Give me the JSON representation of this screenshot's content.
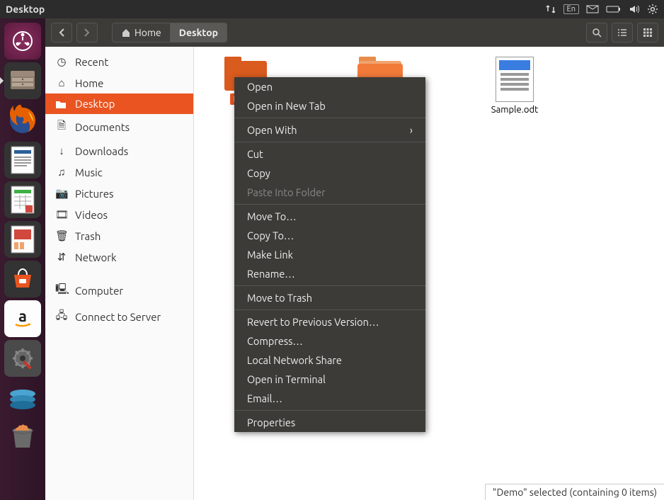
{
  "top_panel": {
    "title": "Desktop",
    "indicators": [
      "network-icon",
      "keyboard-icon",
      "mail-icon",
      "battery-icon",
      "volume-icon",
      "gear-icon"
    ],
    "keyboard_label": "En"
  },
  "launcher": {
    "items": [
      {
        "name": "dash-icon",
        "color": "#dd4814"
      },
      {
        "name": "files-icon",
        "color": "#6b6b6b"
      },
      {
        "name": "firefox-icon",
        "color": "#e66000"
      },
      {
        "name": "writer-icon",
        "color": "#2a6099"
      },
      {
        "name": "calc-icon",
        "color": "#3faf46"
      },
      {
        "name": "impress-icon",
        "color": "#d0483e"
      },
      {
        "name": "software-icon",
        "color": "#e95420"
      },
      {
        "name": "amazon-icon",
        "color": "#f0f0f0"
      },
      {
        "name": "settings-icon",
        "color": "#4a4a4a"
      },
      {
        "name": "devices-icon",
        "color": "#3399cc"
      },
      {
        "name": "trash-icon",
        "color": "#5a5a5a"
      }
    ]
  },
  "toolbar": {
    "back": "‹",
    "forward": "›",
    "path": [
      {
        "label": "Home",
        "icon": "home"
      },
      {
        "label": "Desktop",
        "active": true
      }
    ],
    "search": "search-icon",
    "view_list": "list-icon",
    "view_grid": "grid-icon"
  },
  "sidebar": {
    "items": [
      {
        "icon": "clock",
        "label": "Recent"
      },
      {
        "icon": "home",
        "label": "Home"
      },
      {
        "icon": "folder",
        "label": "Desktop",
        "active": true
      },
      {
        "icon": "doc",
        "label": "Documents"
      },
      {
        "icon": "download",
        "label": "Downloads"
      },
      {
        "icon": "music",
        "label": "Music"
      },
      {
        "icon": "camera",
        "label": "Pictures"
      },
      {
        "icon": "video",
        "label": "Videos"
      },
      {
        "icon": "trash",
        "label": "Trash"
      },
      {
        "icon": "network",
        "label": "Network"
      },
      {
        "icon": "computer",
        "label": "Computer"
      },
      {
        "icon": "server",
        "label": "Connect to Server"
      }
    ]
  },
  "files": [
    {
      "name": "Demo",
      "type": "folder",
      "selected": true
    },
    {
      "name": "",
      "type": "folder-light"
    },
    {
      "name": "Sample.odt",
      "type": "odt"
    }
  ],
  "context_menu": {
    "groups": [
      [
        "Open",
        "Open in New Tab"
      ],
      [
        {
          "label": "Open With",
          "sub": true
        }
      ],
      [
        "Cut",
        "Copy",
        {
          "label": "Paste Into Folder",
          "disabled": true
        }
      ],
      [
        "Move To…",
        "Copy To…",
        "Make Link",
        "Rename…"
      ],
      [
        "Move to Trash"
      ],
      [
        "Revert to Previous Version…",
        "Compress…",
        "Local Network Share",
        "Open in Terminal",
        "Email…"
      ],
      [
        "Properties"
      ]
    ]
  },
  "status": "\"Demo\" selected  (containing 0 items)"
}
